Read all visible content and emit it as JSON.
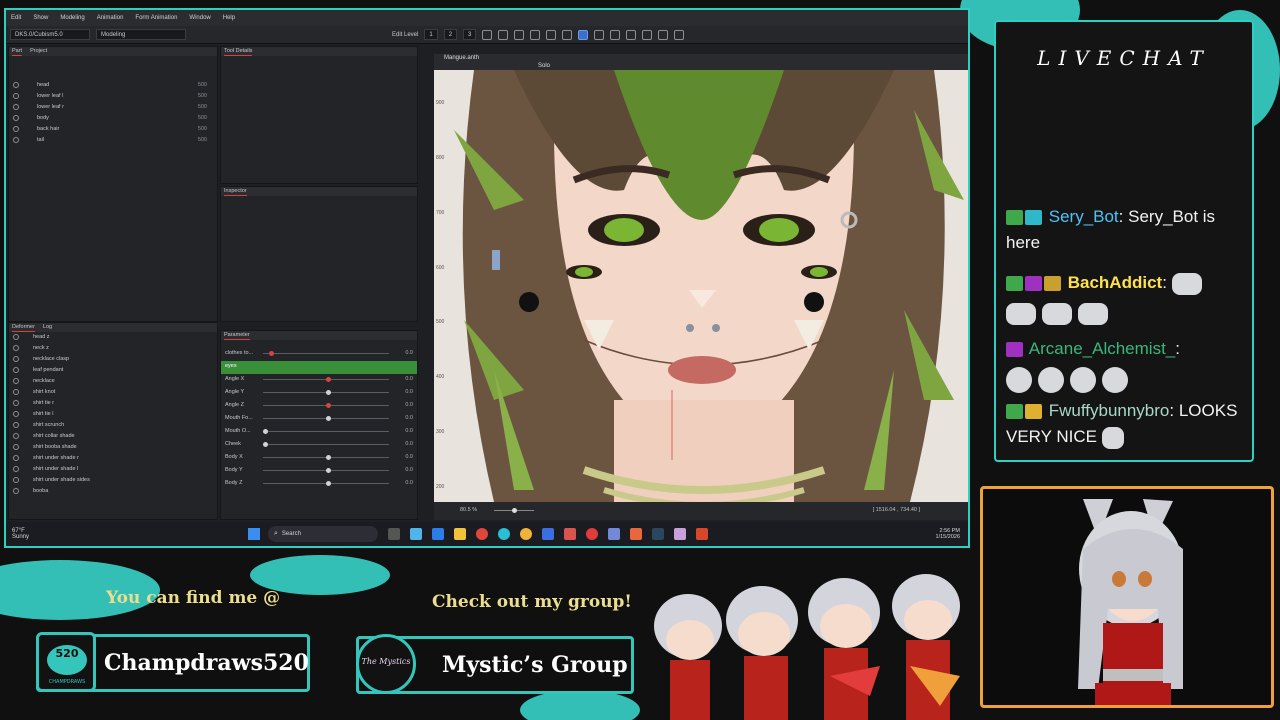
{
  "app": {
    "menu": [
      "Edit",
      "Show",
      "Modeling",
      "Animation",
      "Form Animation",
      "Window",
      "Help"
    ],
    "project_path": "DKS.0/Cubism5.0",
    "mode": "Modeling",
    "edit_level_label": "Edit Level",
    "edit_level_values": [
      "1",
      "2",
      "3"
    ],
    "panels": {
      "part_tabs": [
        "Part",
        "Project"
      ],
      "tool_details": "Tool Details",
      "inspector": "Inspector",
      "deformer_tabs": [
        "Deformer",
        "Log"
      ],
      "parameter": "Parameter"
    },
    "parts": [
      {
        "label": "head",
        "value": "500"
      },
      {
        "label": "lower leaf l",
        "value": "500"
      },
      {
        "label": "lower leaf r",
        "value": "500"
      },
      {
        "label": "body",
        "value": "500"
      },
      {
        "label": "back hair",
        "value": "500"
      },
      {
        "label": "tail",
        "value": "500"
      }
    ],
    "deformers": [
      "head z",
      "neck z",
      "necklace clasp",
      "leaf pendant",
      "necklace",
      "shirt knot",
      "shirt tie r",
      "shirt tie l",
      "shirt scrunch",
      "shirt collar shade",
      "shirt booba shade",
      "shirt under shade r",
      "shirt under shade l",
      "shirt under shade sides",
      "booba"
    ],
    "parameters": [
      {
        "label": "clothes to...",
        "value": "0.0",
        "pos": 0.05
      },
      {
        "label": "eyes",
        "value": "",
        "pos": null
      },
      {
        "label": "Angle X",
        "value": "0.0",
        "pos": 0.5
      },
      {
        "label": "Angle Y",
        "value": "0.0",
        "pos": 0.5
      },
      {
        "label": "Angle Z",
        "value": "0.0",
        "pos": 0.5
      },
      {
        "label": "Mouth Fo...",
        "value": "0.0",
        "pos": 0.5
      },
      {
        "label": "Mouth O...",
        "value": "0.0",
        "pos": 0.0
      },
      {
        "label": "Cheek",
        "value": "0.0",
        "pos": 0.0
      },
      {
        "label": "Body X",
        "value": "0.0",
        "pos": 0.5
      },
      {
        "label": "Body Y",
        "value": "0.0",
        "pos": 0.5
      },
      {
        "label": "Body Z",
        "value": "0.0",
        "pos": 0.5
      }
    ],
    "viewport_tab": "Mangue.anth",
    "solo_label": "Solo",
    "zoom": "80.5 %",
    "ruler": [
      "900",
      "800",
      "700",
      "600",
      "500",
      "400",
      "300",
      "200"
    ],
    "coords": "[ 1516.04 , 734.40 ]"
  },
  "taskbar": {
    "weather_temp": "67°F",
    "weather_desc": "Sunny",
    "search": "Search",
    "time": "2:56 PM",
    "date": "1/15/2026"
  },
  "chat": {
    "title": "LIVECHAT",
    "messages": [
      {
        "user": "Sery_Bot",
        "text": "Sery_Bot is here",
        "color": "#4fc3f7"
      },
      {
        "user": "BachAddict",
        "text": "",
        "color": "#ffe14d"
      },
      {
        "user": "Arcane_Alchemist_",
        "text": "",
        "color": "#3bb77e"
      },
      {
        "user": "Fwuffybunnybro",
        "text": "LOOKS VERY NICE",
        "color": "#a7d8c8"
      }
    ]
  },
  "banner": {
    "find_me": "You can find me @",
    "group_prompt": "Check out my group!",
    "handle": "Champdraws520",
    "group_name": "Mystic’s Group",
    "logo_text": "520",
    "logo_sub": "CHAMPDRAWS",
    "group_logo_text": "The Mystics"
  },
  "colors": {
    "accent": "#2fd0c4",
    "cam_border": "#f0a23a",
    "banner_text": "#ecde8e"
  }
}
